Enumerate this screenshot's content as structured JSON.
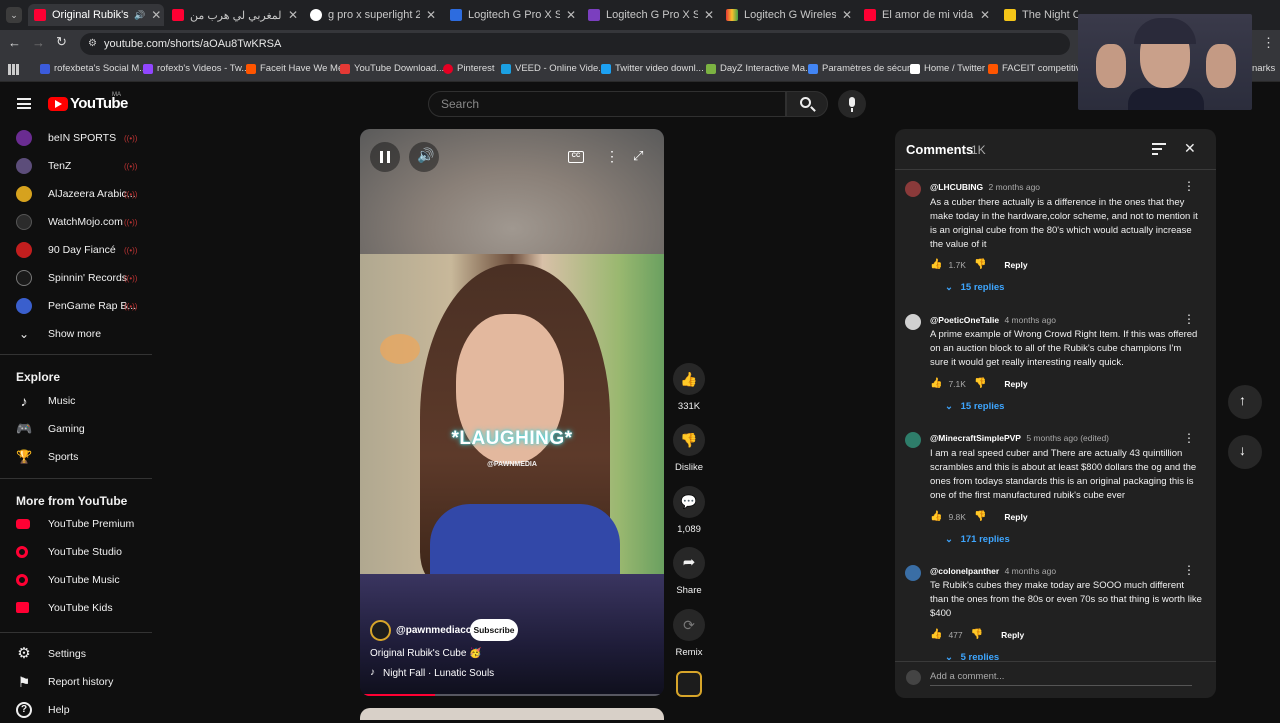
{
  "browser": {
    "tabs": [
      {
        "label": "Original Rubik's Cube",
        "color": "#ff0033"
      },
      {
        "label": "قصة المغربي لي هرب من",
        "color": "#ff0033"
      },
      {
        "label": "g pro x superlight 2 marc",
        "color": "#ffffff"
      },
      {
        "label": "Logitech G Pro X Superlig",
        "color": "#2d6cdf"
      },
      {
        "label": "Logitech G Pro X Superlig",
        "color": "#7b3fbf"
      },
      {
        "label": "Logitech G Wireless Gami",
        "color": "#e0b030"
      },
      {
        "label": "El amor de mi vida me im",
        "color": "#ff0033"
      },
      {
        "label": "The Night Of (TV Mini S",
        "color": "#f5c518"
      }
    ],
    "url": "youtube.com/shorts/aOAu8TwKRSA",
    "bookmarks": [
      {
        "label": "rofexbeta's Social M...",
        "color": "#3b5bdb"
      },
      {
        "label": "rofexb's Videos - Tw...",
        "color": "#9146ff"
      },
      {
        "label": "Faceit Have We Met",
        "color": "#ff5500"
      },
      {
        "label": "YouTube Download...",
        "color": "#e53935"
      },
      {
        "label": "Pinterest",
        "color": "#e60023"
      },
      {
        "label": "VEED - Online Vide...",
        "color": "#1ba0e2"
      },
      {
        "label": "Twitter video downl...",
        "color": "#1da1f2"
      },
      {
        "label": "DayZ Interactive Ma...",
        "color": "#7cb342"
      },
      {
        "label": "Paramètres de sécur...",
        "color": "#4285f4"
      },
      {
        "label": "Home / Twitter",
        "color": "#ffffff"
      },
      {
        "label": "FACEIT competitive...",
        "color": "#ff5500"
      }
    ],
    "bookmarks_overflow": "narks"
  },
  "youtube": {
    "logo_text": "YouTube",
    "country": "MA",
    "search_placeholder": "Search"
  },
  "sidebar": {
    "subscriptions": [
      {
        "label": "beIN SPORTS",
        "color": "#6a2c91"
      },
      {
        "label": "TenZ",
        "color": "#5c4d7a"
      },
      {
        "label": "AlJazeera Arabic...",
        "color": "#d6a21e"
      },
      {
        "label": "WatchMojo.com",
        "color": "#2b2b2b"
      },
      {
        "label": "90 Day Fiancé",
        "color": "#c21e1e"
      },
      {
        "label": "Spinnin' Records",
        "color": "#1a1a1a"
      },
      {
        "label": "PenGame Rap B...",
        "color": "#3a5fcd"
      }
    ],
    "show_more": "Show more",
    "explore_title": "Explore",
    "explore": [
      "Music",
      "Gaming",
      "Sports"
    ],
    "more_title": "More from YouTube",
    "more": [
      "YouTube Premium",
      "YouTube Studio",
      "YouTube Music",
      "YouTube Kids"
    ],
    "footer": [
      "Settings",
      "Report history",
      "Help"
    ]
  },
  "video": {
    "caption": "*LAUGHING*",
    "watermark": "@PAWNMEDIA",
    "channel": "@pawnmediaco",
    "subscribe": "Subscribe",
    "title": "Original Rubik's Cube 🥳",
    "music": "Night Fall · Lunatic Souls",
    "progress": 0.24
  },
  "actions": {
    "likes": "331K",
    "dislike": "Dislike",
    "comments": "1,089",
    "share": "Share",
    "remix": "Remix"
  },
  "comments": {
    "title": "Comments",
    "count": "1K",
    "items": [
      {
        "handle": "@LHCUBING",
        "ago": "2 months ago",
        "text": "As a cuber there actually is a difference in the ones that they make today in the hardware,color scheme, and not to mention it is an original cube from the 80's which would actually increase the value of it",
        "likes": "1.7K",
        "replies": "15 replies",
        "avatar": "#8a3a3a"
      },
      {
        "handle": "@PoeticOneTalie",
        "ago": "4 months ago",
        "text": "A prime example of Wrong Crowd Right Item. If this was offered on an auction block to all of the Rubik's cube champions I'm sure it would get really interesting really quick.",
        "likes": "7.1K",
        "replies": "15 replies",
        "avatar": "#d0d0d0"
      },
      {
        "handle": "@MinecraftSimplePVP",
        "ago": "5 months ago (edited)",
        "text": "I am a real speed cuber and There are actually 43 quintillion scrambles and this is about at least $800 dollars the og and the ones from todays standards this is an original packaging      this is one of the first manufactured rubik's cube ever",
        "likes": "9.8K",
        "replies": "171 replies",
        "avatar": "#2e7d6a"
      },
      {
        "handle": "@colonelpanther",
        "ago": "4 months ago",
        "text": "Te Rubik's cubes they make today are SOOO much different than the ones from the 80s or even 70s so that thing is worth like $400",
        "likes": "477",
        "replies": "5 replies",
        "avatar": "#3a6ea5"
      }
    ],
    "reply_label": "Reply",
    "add_comment": "Add a comment..."
  }
}
